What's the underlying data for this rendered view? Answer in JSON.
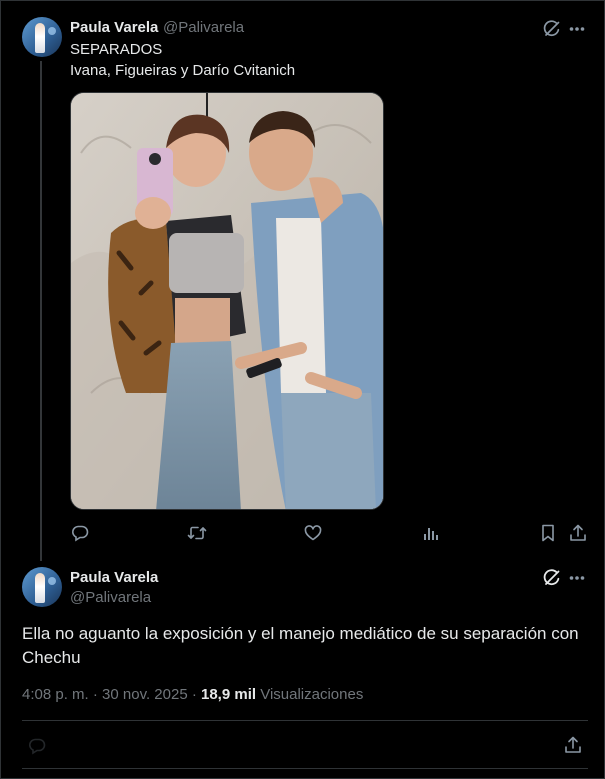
{
  "tweet1": {
    "author_name": "Paula Varela",
    "author_handle": "@Palivarela",
    "text_line1": "SEPARADOS",
    "text_line2": "Ivana, Figueiras y Darío Cvitanich",
    "image_alt": "Photo of a couple taking a mirror selfie",
    "actions": [
      "reply-icon",
      "retweet-icon",
      "like-icon",
      "views-icon",
      "bookmark-icon",
      "share-icon"
    ]
  },
  "tweet2": {
    "author_name": "Paula Varela",
    "author_handle": "@Palivarela",
    "text": "Ella no aguanto la exposición y el manejo mediático de su separación con Chechu",
    "time": "4:08 p. m. · 30 nov. 2025 · ",
    "views_count": "18,9 mil",
    "views_label": " Visualizaciones"
  },
  "colors": {
    "background": "#000000",
    "primary_text": "#e7e9ea",
    "secondary_text": "#71767b",
    "divider": "#2f3336"
  }
}
